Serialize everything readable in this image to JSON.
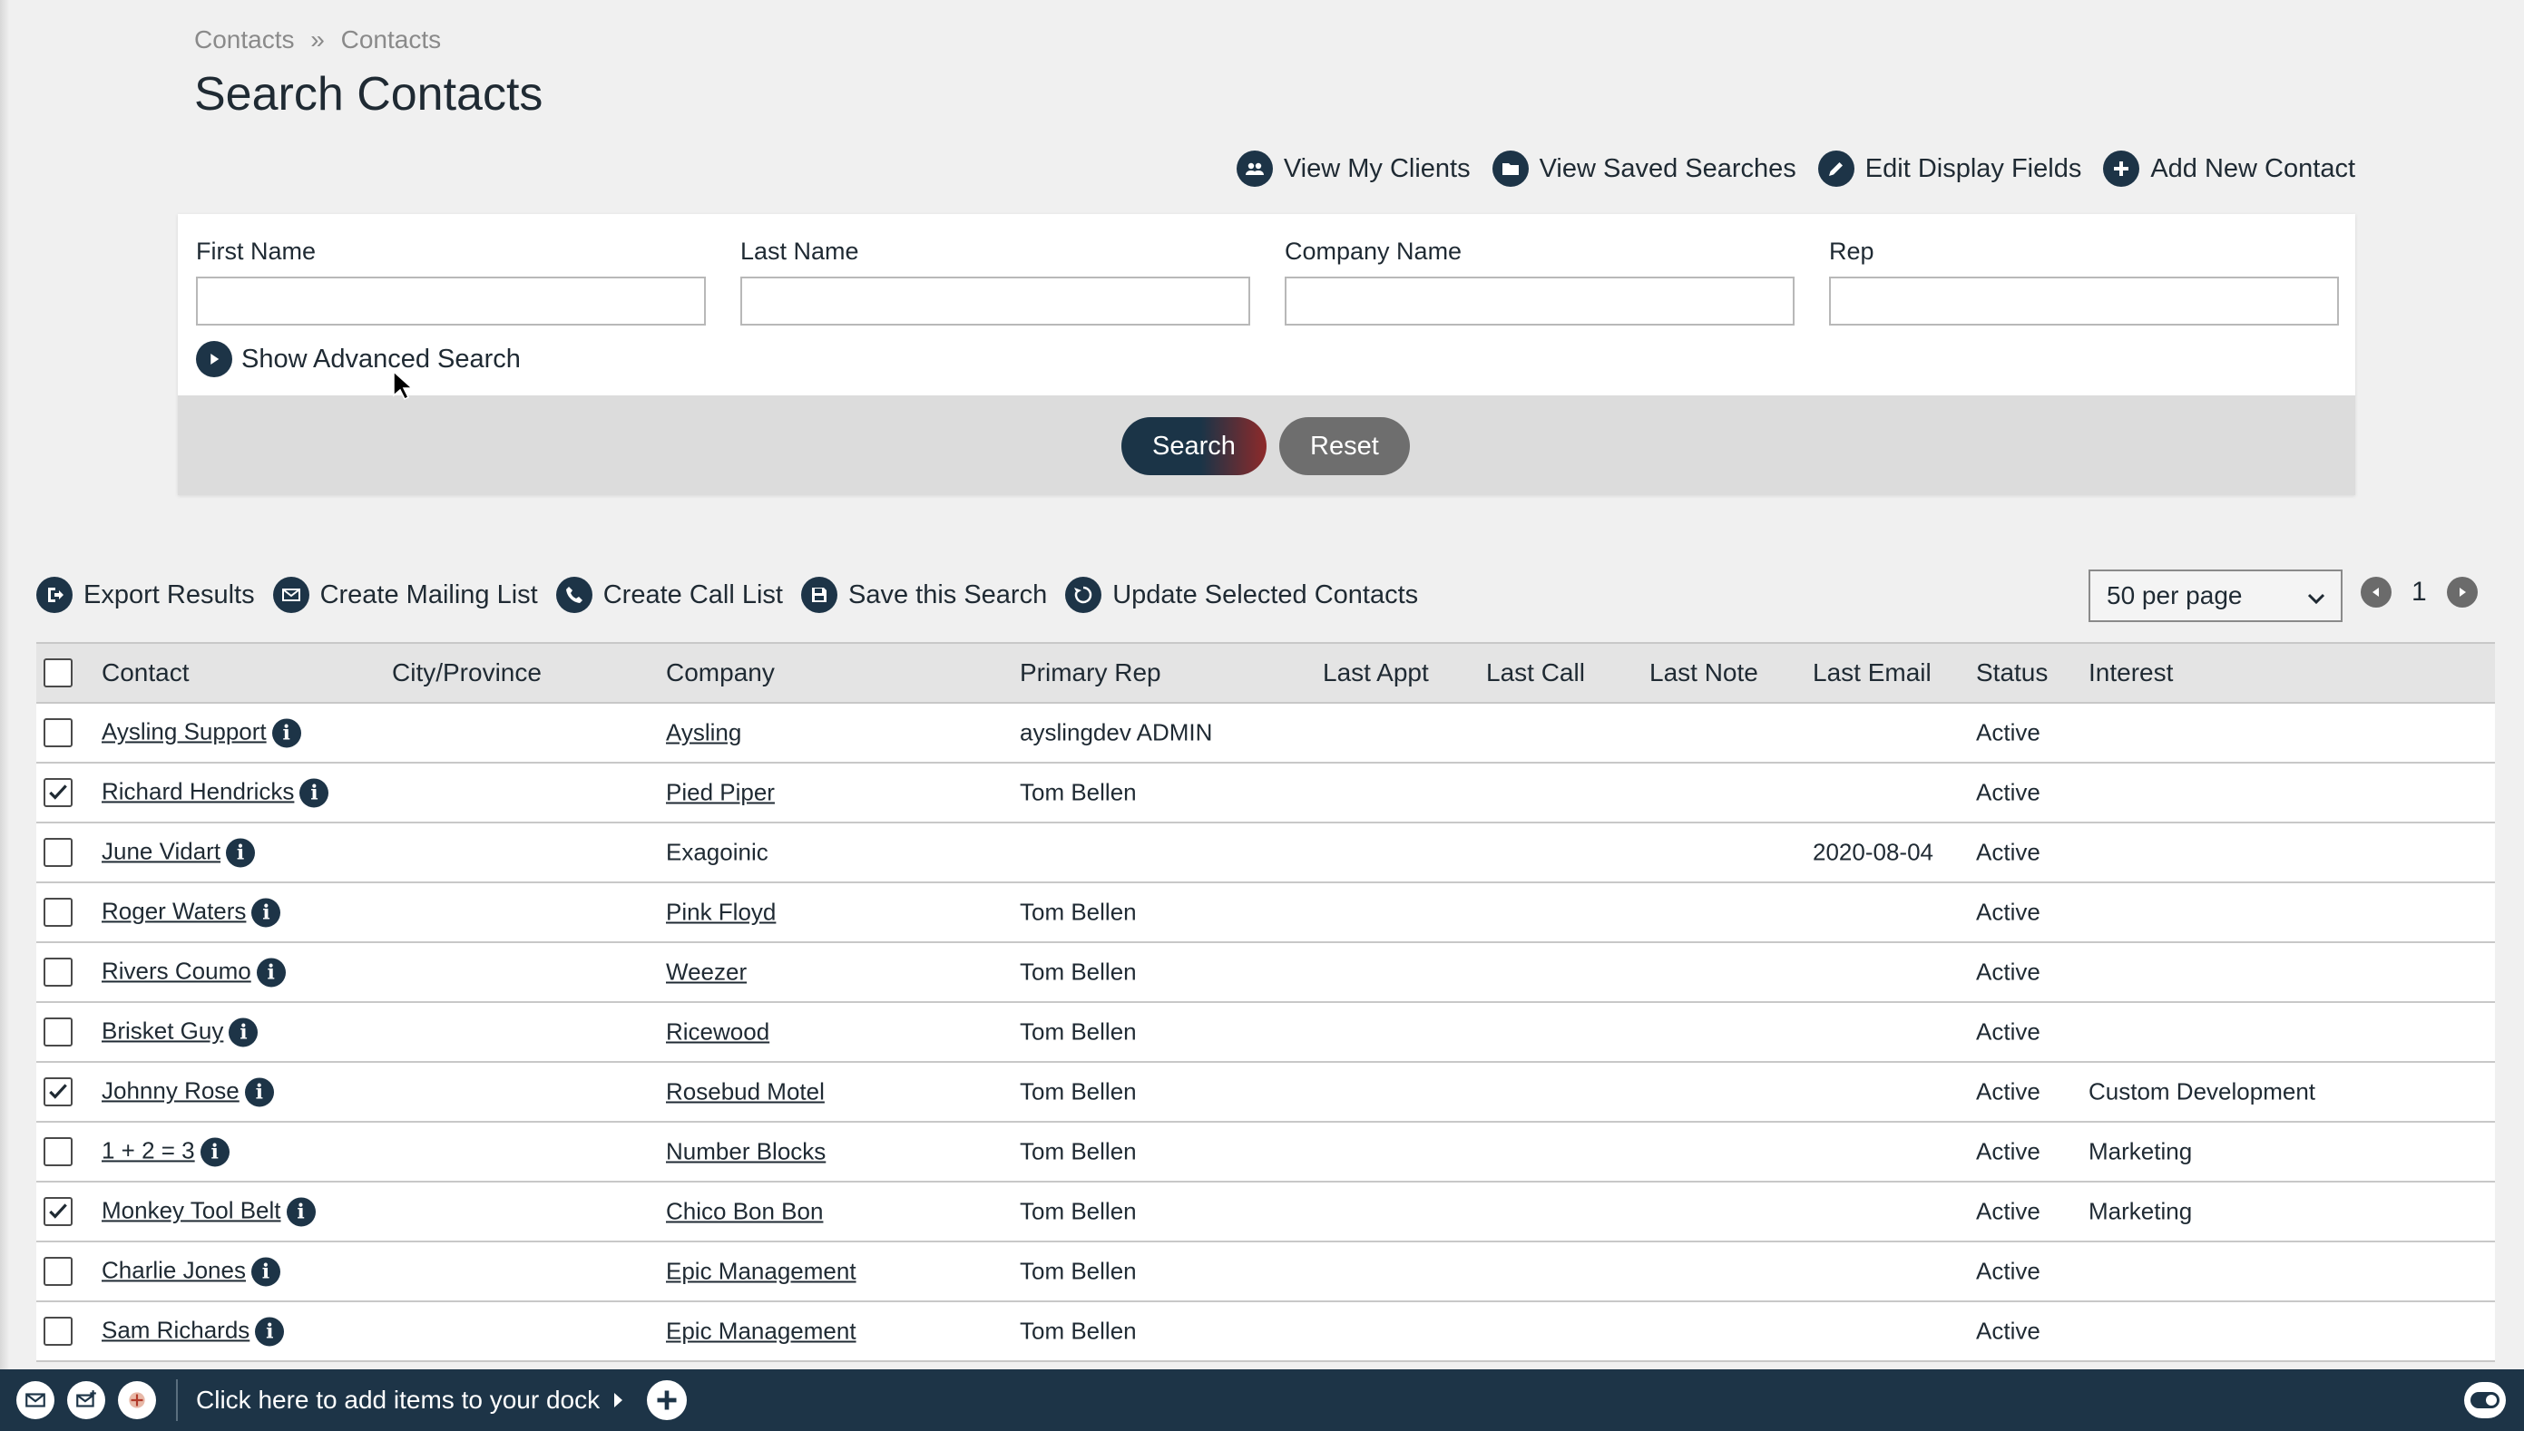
{
  "breadcrumb": [
    "Contacts",
    "»",
    "Contacts"
  ],
  "page_title": "Search Contacts",
  "top_actions": {
    "view_my_clients": "View My Clients",
    "view_saved_searches": "View Saved Searches",
    "edit_display_fields": "Edit Display Fields",
    "add_new_contact": "Add New Contact"
  },
  "search": {
    "first_name_label": "First Name",
    "last_name_label": "Last Name",
    "company_name_label": "Company Name",
    "rep_label": "Rep",
    "first_name_value": "",
    "last_name_value": "",
    "company_name_value": "",
    "rep_value": "",
    "show_advanced": "Show Advanced Search",
    "search_button": "Search",
    "reset_button": "Reset"
  },
  "results_tools": {
    "export": "Export Results",
    "mailing": "Create Mailing List",
    "call": "Create Call List",
    "save": "Save this Search",
    "update": "Update Selected Contacts",
    "per_page": "50 per page",
    "page": "1"
  },
  "columns": [
    "Contact",
    "City/Province",
    "Company",
    "Primary Rep",
    "Last Appt",
    "Last Call",
    "Last Note",
    "Last Email",
    "Status",
    "Interest"
  ],
  "rows": [
    {
      "checked": false,
      "contact": "Aysling Support",
      "city": "",
      "company": "Aysling",
      "company_link": true,
      "rep": "ayslingdev ADMIN",
      "last_email": "",
      "status": "Active",
      "interest": ""
    },
    {
      "checked": true,
      "contact": "Richard Hendricks",
      "city": "",
      "company": "Pied Piper",
      "company_link": true,
      "rep": "Tom Bellen",
      "last_email": "",
      "status": "Active",
      "interest": ""
    },
    {
      "checked": false,
      "contact": "June Vidart",
      "city": "",
      "company": "Exagoinic",
      "company_link": false,
      "rep": "",
      "last_email": "2020-08-04",
      "status": "Active",
      "interest": ""
    },
    {
      "checked": false,
      "contact": "Roger Waters",
      "city": "",
      "company": "Pink Floyd",
      "company_link": true,
      "rep": "Tom Bellen",
      "last_email": "",
      "status": "Active",
      "interest": ""
    },
    {
      "checked": false,
      "contact": "Rivers Coumo",
      "city": "",
      "company": "Weezer",
      "company_link": true,
      "rep": "Tom Bellen",
      "last_email": "",
      "status": "Active",
      "interest": ""
    },
    {
      "checked": false,
      "contact": "Brisket Guy",
      "city": "",
      "company": "Ricewood",
      "company_link": true,
      "rep": "Tom Bellen",
      "last_email": "",
      "status": "Active",
      "interest": ""
    },
    {
      "checked": true,
      "contact": "Johnny Rose",
      "city": "",
      "company": "Rosebud Motel",
      "company_link": true,
      "rep": "Tom Bellen",
      "last_email": "",
      "status": "Active",
      "interest": "Custom Development"
    },
    {
      "checked": false,
      "contact": "1 + 2 = 3",
      "city": "",
      "company": "Number Blocks",
      "company_link": true,
      "rep": "Tom Bellen",
      "last_email": "",
      "status": "Active",
      "interest": "Marketing"
    },
    {
      "checked": true,
      "contact": "Monkey Tool Belt",
      "city": "",
      "company": "Chico Bon Bon",
      "company_link": true,
      "rep": "Tom Bellen",
      "last_email": "",
      "status": "Active",
      "interest": "Marketing"
    },
    {
      "checked": false,
      "contact": "Charlie Jones",
      "city": "",
      "company": "Epic Management",
      "company_link": true,
      "rep": "Tom Bellen",
      "last_email": "",
      "status": "Active",
      "interest": ""
    },
    {
      "checked": false,
      "contact": "Sam Richards",
      "city": "",
      "company": "Epic Management",
      "company_link": true,
      "rep": "Tom Bellen",
      "last_email": "",
      "status": "Active",
      "interest": ""
    }
  ],
  "dock": {
    "hint": "Click here to add items to your dock"
  },
  "colors": {
    "navy": "#1d3447",
    "search_accent": "#8e2a2a",
    "reset": "#6e6e6e"
  }
}
